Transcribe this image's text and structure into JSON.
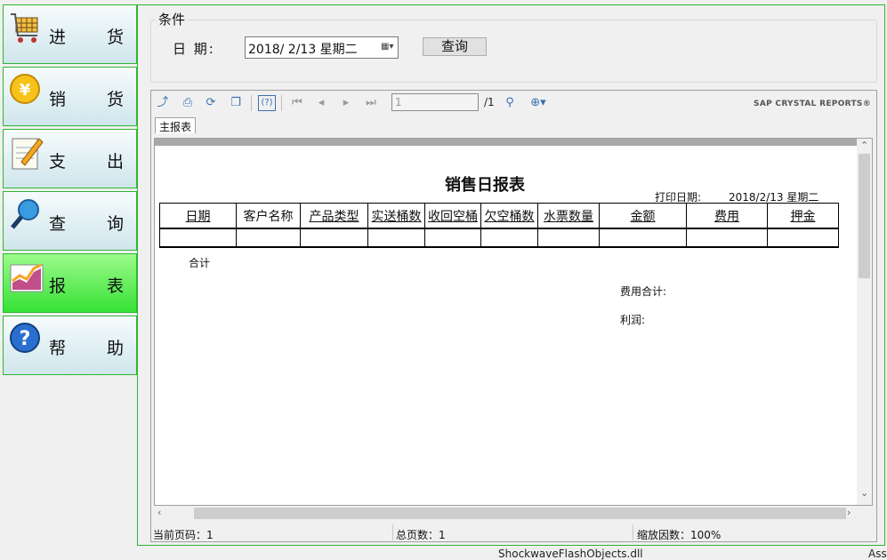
{
  "sidebar": {
    "items": [
      {
        "label": "进 货",
        "icon": "shopping-cart-icon",
        "active": false
      },
      {
        "label": "销 货",
        "icon": "yen-coin-icon",
        "active": false
      },
      {
        "label": "支 出",
        "icon": "notepad-pencil-icon",
        "active": false
      },
      {
        "label": "查 询",
        "icon": "magnifier-icon",
        "active": false
      },
      {
        "label": "报 表",
        "icon": "chart-icon",
        "active": true
      },
      {
        "label": "帮 助",
        "icon": "help-icon",
        "active": false
      }
    ]
  },
  "condition": {
    "legend": "条件",
    "date_label": "日  期:",
    "date_value": "2018/ 2/13 星期二",
    "query_button": "查询"
  },
  "viewer": {
    "page_input": "1",
    "page_total": "/1",
    "brand": "SAP CRYSTAL REPORTS®",
    "tab": "主报表"
  },
  "report": {
    "title": "销售日报表",
    "print_date_label": "打印日期:",
    "print_date": "2018/2/13 星期二",
    "columns": [
      "日期",
      "客户名称",
      "产品类型",
      "实送桶数",
      "收回空桶",
      "欠空桶数",
      "水票数量",
      "金额",
      "费用",
      "押金"
    ],
    "sum_label": "合计",
    "fee_total_label": "费用合计:",
    "profit_label": "利润:"
  },
  "status": {
    "current_page": "当前页码：1",
    "total_pages": "总页数：1",
    "zoom": "缩放因数：100%"
  },
  "background": {
    "file_text": "ShockwaveFlashObjects.dll",
    "right_text": "Ass"
  },
  "colors": {
    "border_green": "#2fb52f",
    "active_green": "#36e136"
  }
}
